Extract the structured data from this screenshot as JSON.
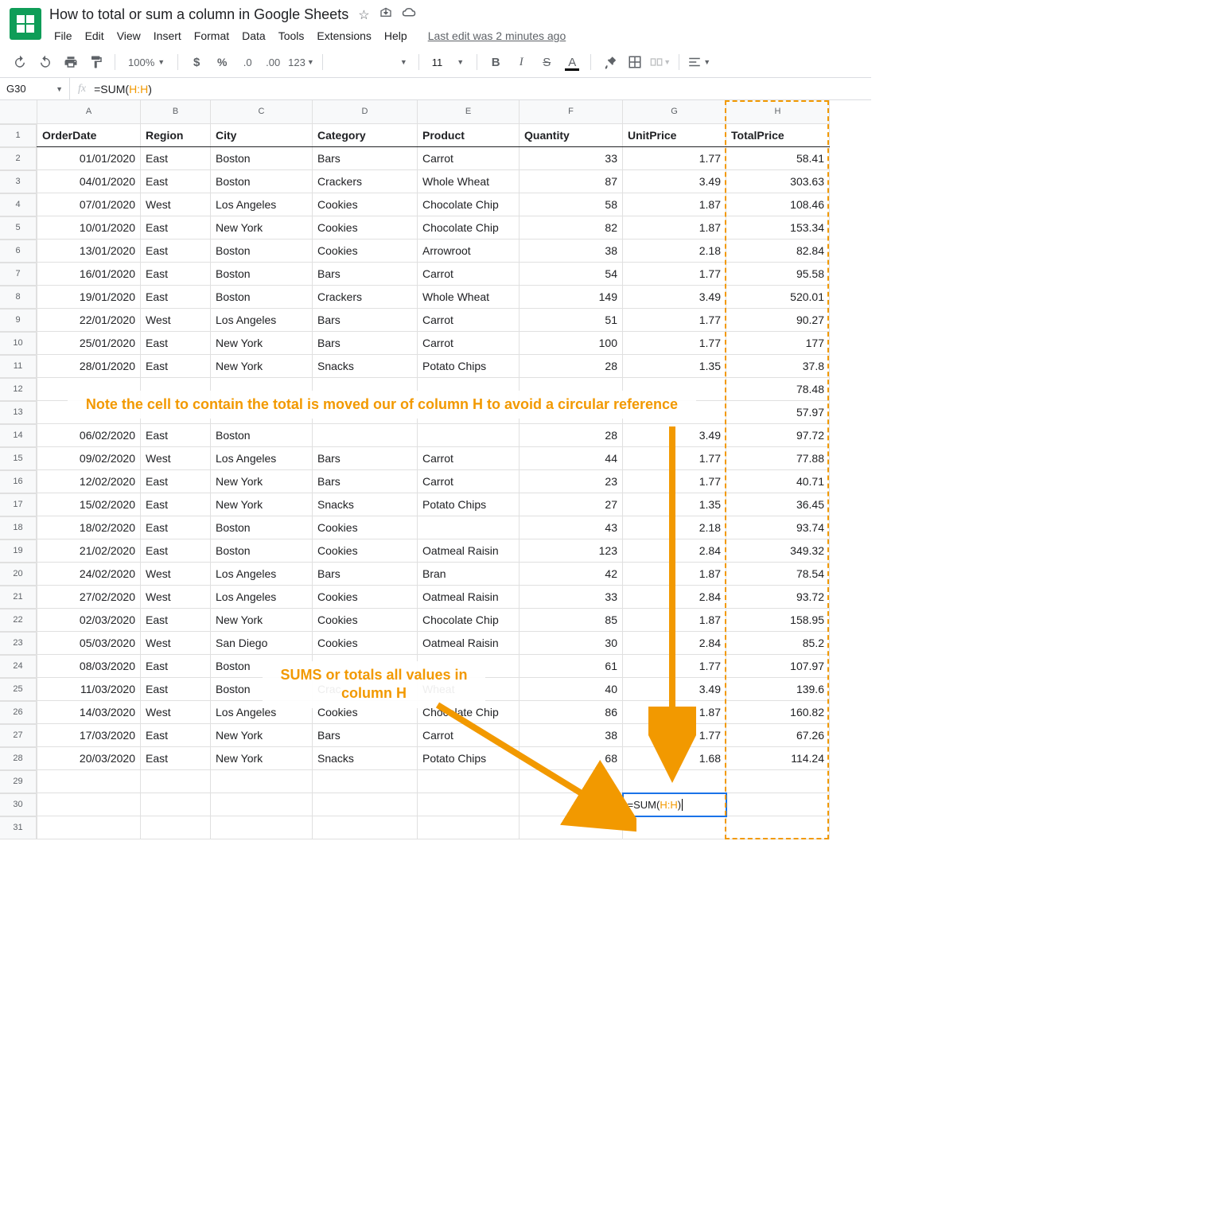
{
  "title": "How to total or sum a column in Google Sheets",
  "menu": [
    "File",
    "Edit",
    "View",
    "Insert",
    "Format",
    "Data",
    "Tools",
    "Extensions",
    "Help"
  ],
  "last_edit": "Last edit was 2 minutes ago",
  "toolbar": {
    "zoom": "100%",
    "font_size": "11",
    "num_fmt": "123"
  },
  "cell_ref": "G30",
  "formula_prefix": "=SUM(",
  "formula_ref": "H:H",
  "formula_suffix": ")",
  "columns": [
    "A",
    "B",
    "C",
    "D",
    "E",
    "F",
    "G",
    "H"
  ],
  "headers": [
    "OrderDate",
    "Region",
    "City",
    "Category",
    "Product",
    "Quantity",
    "UnitPrice",
    "TotalPrice"
  ],
  "rows": [
    [
      "01/01/2020",
      "East",
      "Boston",
      "Bars",
      "Carrot",
      "33",
      "1.77",
      "58.41"
    ],
    [
      "04/01/2020",
      "East",
      "Boston",
      "Crackers",
      "Whole Wheat",
      "87",
      "3.49",
      "303.63"
    ],
    [
      "07/01/2020",
      "West",
      "Los Angeles",
      "Cookies",
      "Chocolate Chip",
      "58",
      "1.87",
      "108.46"
    ],
    [
      "10/01/2020",
      "East",
      "New York",
      "Cookies",
      "Chocolate Chip",
      "82",
      "1.87",
      "153.34"
    ],
    [
      "13/01/2020",
      "East",
      "Boston",
      "Cookies",
      "Arrowroot",
      "38",
      "2.18",
      "82.84"
    ],
    [
      "16/01/2020",
      "East",
      "Boston",
      "Bars",
      "Carrot",
      "54",
      "1.77",
      "95.58"
    ],
    [
      "19/01/2020",
      "East",
      "Boston",
      "Crackers",
      "Whole Wheat",
      "149",
      "3.49",
      "520.01"
    ],
    [
      "22/01/2020",
      "West",
      "Los Angeles",
      "Bars",
      "Carrot",
      "51",
      "1.77",
      "90.27"
    ],
    [
      "25/01/2020",
      "East",
      "New York",
      "Bars",
      "Carrot",
      "100",
      "1.77",
      "177"
    ],
    [
      "28/01/2020",
      "East",
      "New York",
      "Snacks",
      "Potato Chips",
      "28",
      "1.35",
      "37.8"
    ],
    [
      "",
      "",
      "",
      "",
      "",
      "",
      "",
      "78.48"
    ],
    [
      "",
      "",
      "",
      "",
      "",
      "",
      "",
      "57.97"
    ],
    [
      "06/02/2020",
      "East",
      "Boston",
      "",
      "",
      "28",
      "3.49",
      "97.72"
    ],
    [
      "09/02/2020",
      "West",
      "Los Angeles",
      "Bars",
      "Carrot",
      "44",
      "1.77",
      "77.88"
    ],
    [
      "12/02/2020",
      "East",
      "New York",
      "Bars",
      "Carrot",
      "23",
      "1.77",
      "40.71"
    ],
    [
      "15/02/2020",
      "East",
      "New York",
      "Snacks",
      "Potato Chips",
      "27",
      "1.35",
      "36.45"
    ],
    [
      "18/02/2020",
      "East",
      "Boston",
      "Cookies",
      "",
      "43",
      "2.18",
      "93.74"
    ],
    [
      "21/02/2020",
      "East",
      "Boston",
      "Cookies",
      "Oatmeal Raisin",
      "123",
      "2.84",
      "349.32"
    ],
    [
      "24/02/2020",
      "West",
      "Los Angeles",
      "Bars",
      "Bran",
      "42",
      "1.87",
      "78.54"
    ],
    [
      "27/02/2020",
      "West",
      "Los Angeles",
      "Cookies",
      "Oatmeal Raisin",
      "33",
      "2.84",
      "93.72"
    ],
    [
      "02/03/2020",
      "East",
      "New York",
      "Cookies",
      "Chocolate Chip",
      "85",
      "1.87",
      "158.95"
    ],
    [
      "05/03/2020",
      "West",
      "San Diego",
      "Cookies",
      "Oatmeal Raisin",
      "30",
      "2.84",
      "85.2"
    ],
    [
      "08/03/2020",
      "East",
      "Boston",
      "",
      "",
      "61",
      "1.77",
      "107.97"
    ],
    [
      "11/03/2020",
      "East",
      "Boston",
      "Crac",
      "Wheat",
      "40",
      "3.49",
      "139.6"
    ],
    [
      "14/03/2020",
      "West",
      "Los Angeles",
      "Cookies",
      "Chocolate Chip",
      "86",
      "1.87",
      "160.82"
    ],
    [
      "17/03/2020",
      "East",
      "New York",
      "Bars",
      "Carrot",
      "38",
      "1.77",
      "67.26"
    ],
    [
      "20/03/2020",
      "East",
      "New York",
      "Snacks",
      "Potato Chips",
      "68",
      "1.68",
      "114.24"
    ]
  ],
  "annotation1": "Note the cell to contain the total is moved our of column H to avoid a circular reference",
  "annotation2": "SUMS or totals all values in column H",
  "active_formula_prefix": "=SUM(",
  "active_formula_ref": "H:H",
  "active_formula_suffix": ")"
}
